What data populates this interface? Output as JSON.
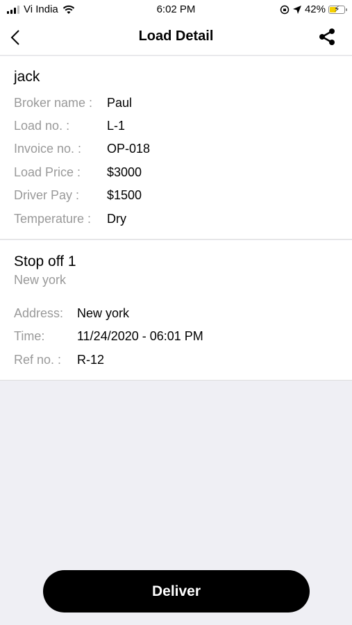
{
  "status_bar": {
    "carrier": "Vi India",
    "time": "6:02 PM",
    "battery": "42%"
  },
  "header": {
    "title": "Load Detail",
    "back_icon": "chevron-left-icon",
    "share_icon": "share-icon"
  },
  "load": {
    "name": "jack",
    "fields": [
      {
        "label": "Broker name :",
        "value": "Paul"
      },
      {
        "label": "Load no. :",
        "value": "L-1"
      },
      {
        "label": "Invoice no. :",
        "value": "OP-018"
      },
      {
        "label": "Load Price :",
        "value": "$3000"
      },
      {
        "label": "Driver Pay :",
        "value": "$1500"
      },
      {
        "label": "Temperature :",
        "value": "Dry"
      }
    ]
  },
  "stop": {
    "title": "Stop off 1",
    "city": "New york",
    "fields": [
      {
        "label": "Address:",
        "value": "New york"
      },
      {
        "label": "Time:",
        "value": "11/24/2020 - 06:01 PM"
      },
      {
        "label": "Ref no. :",
        "value": "R-12"
      }
    ]
  },
  "actions": {
    "deliver_label": "Deliver"
  },
  "colors": {
    "background": "#efeff4",
    "label": "#999999",
    "button": "#000000"
  }
}
